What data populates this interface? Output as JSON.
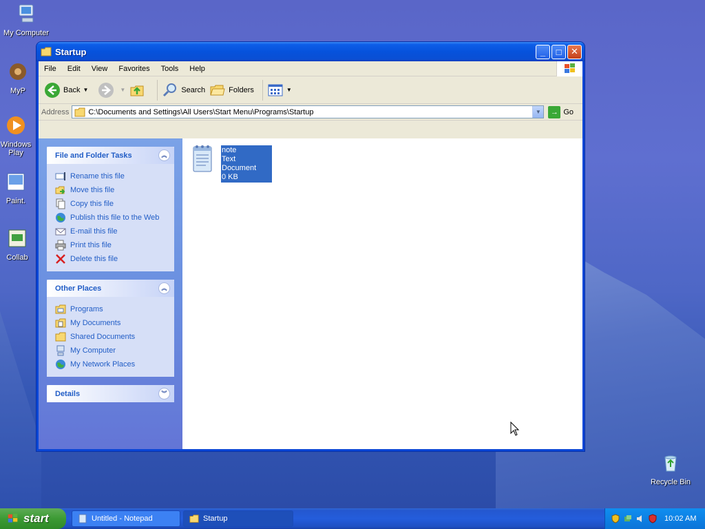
{
  "desktop": {
    "icons": [
      {
        "label": "My Computer"
      },
      {
        "label": "MyP"
      },
      {
        "label": "Windows Play"
      },
      {
        "label": "Paint."
      },
      {
        "label": "Collab"
      },
      {
        "label": "Recycle Bin"
      }
    ]
  },
  "window": {
    "title": "Startup",
    "controls": {
      "minimize": "_",
      "maximize": "□",
      "close": "✕"
    }
  },
  "menubar": [
    "File",
    "Edit",
    "View",
    "Favorites",
    "Tools",
    "Help"
  ],
  "toolbar": {
    "back": "Back",
    "search": "Search",
    "folders": "Folders"
  },
  "address": {
    "label": "Address",
    "value": "C:\\Documents and Settings\\All Users\\Start Menu\\Programs\\Startup",
    "go": "Go"
  },
  "taskpane": {
    "file_tasks": {
      "title": "File and Folder Tasks",
      "items": [
        "Rename this file",
        "Move this file",
        "Copy this file",
        "Publish this file to the Web",
        "E-mail this file",
        "Print this file",
        "Delete this file"
      ]
    },
    "other_places": {
      "title": "Other Places",
      "items": [
        "Programs",
        "My Documents",
        "Shared Documents",
        "My Computer",
        "My Network Places"
      ]
    },
    "details": {
      "title": "Details"
    }
  },
  "files": [
    {
      "name": "note",
      "type": "Text Document",
      "size": "0 KB"
    }
  ],
  "taskbar": {
    "start": "start",
    "tasks": [
      "Untitled - Notepad",
      "Startup"
    ],
    "clock": "10:02 AM"
  },
  "colors": {
    "link": "#215dc6",
    "selection": "#316ac5",
    "titlebar": "#0652dc"
  }
}
